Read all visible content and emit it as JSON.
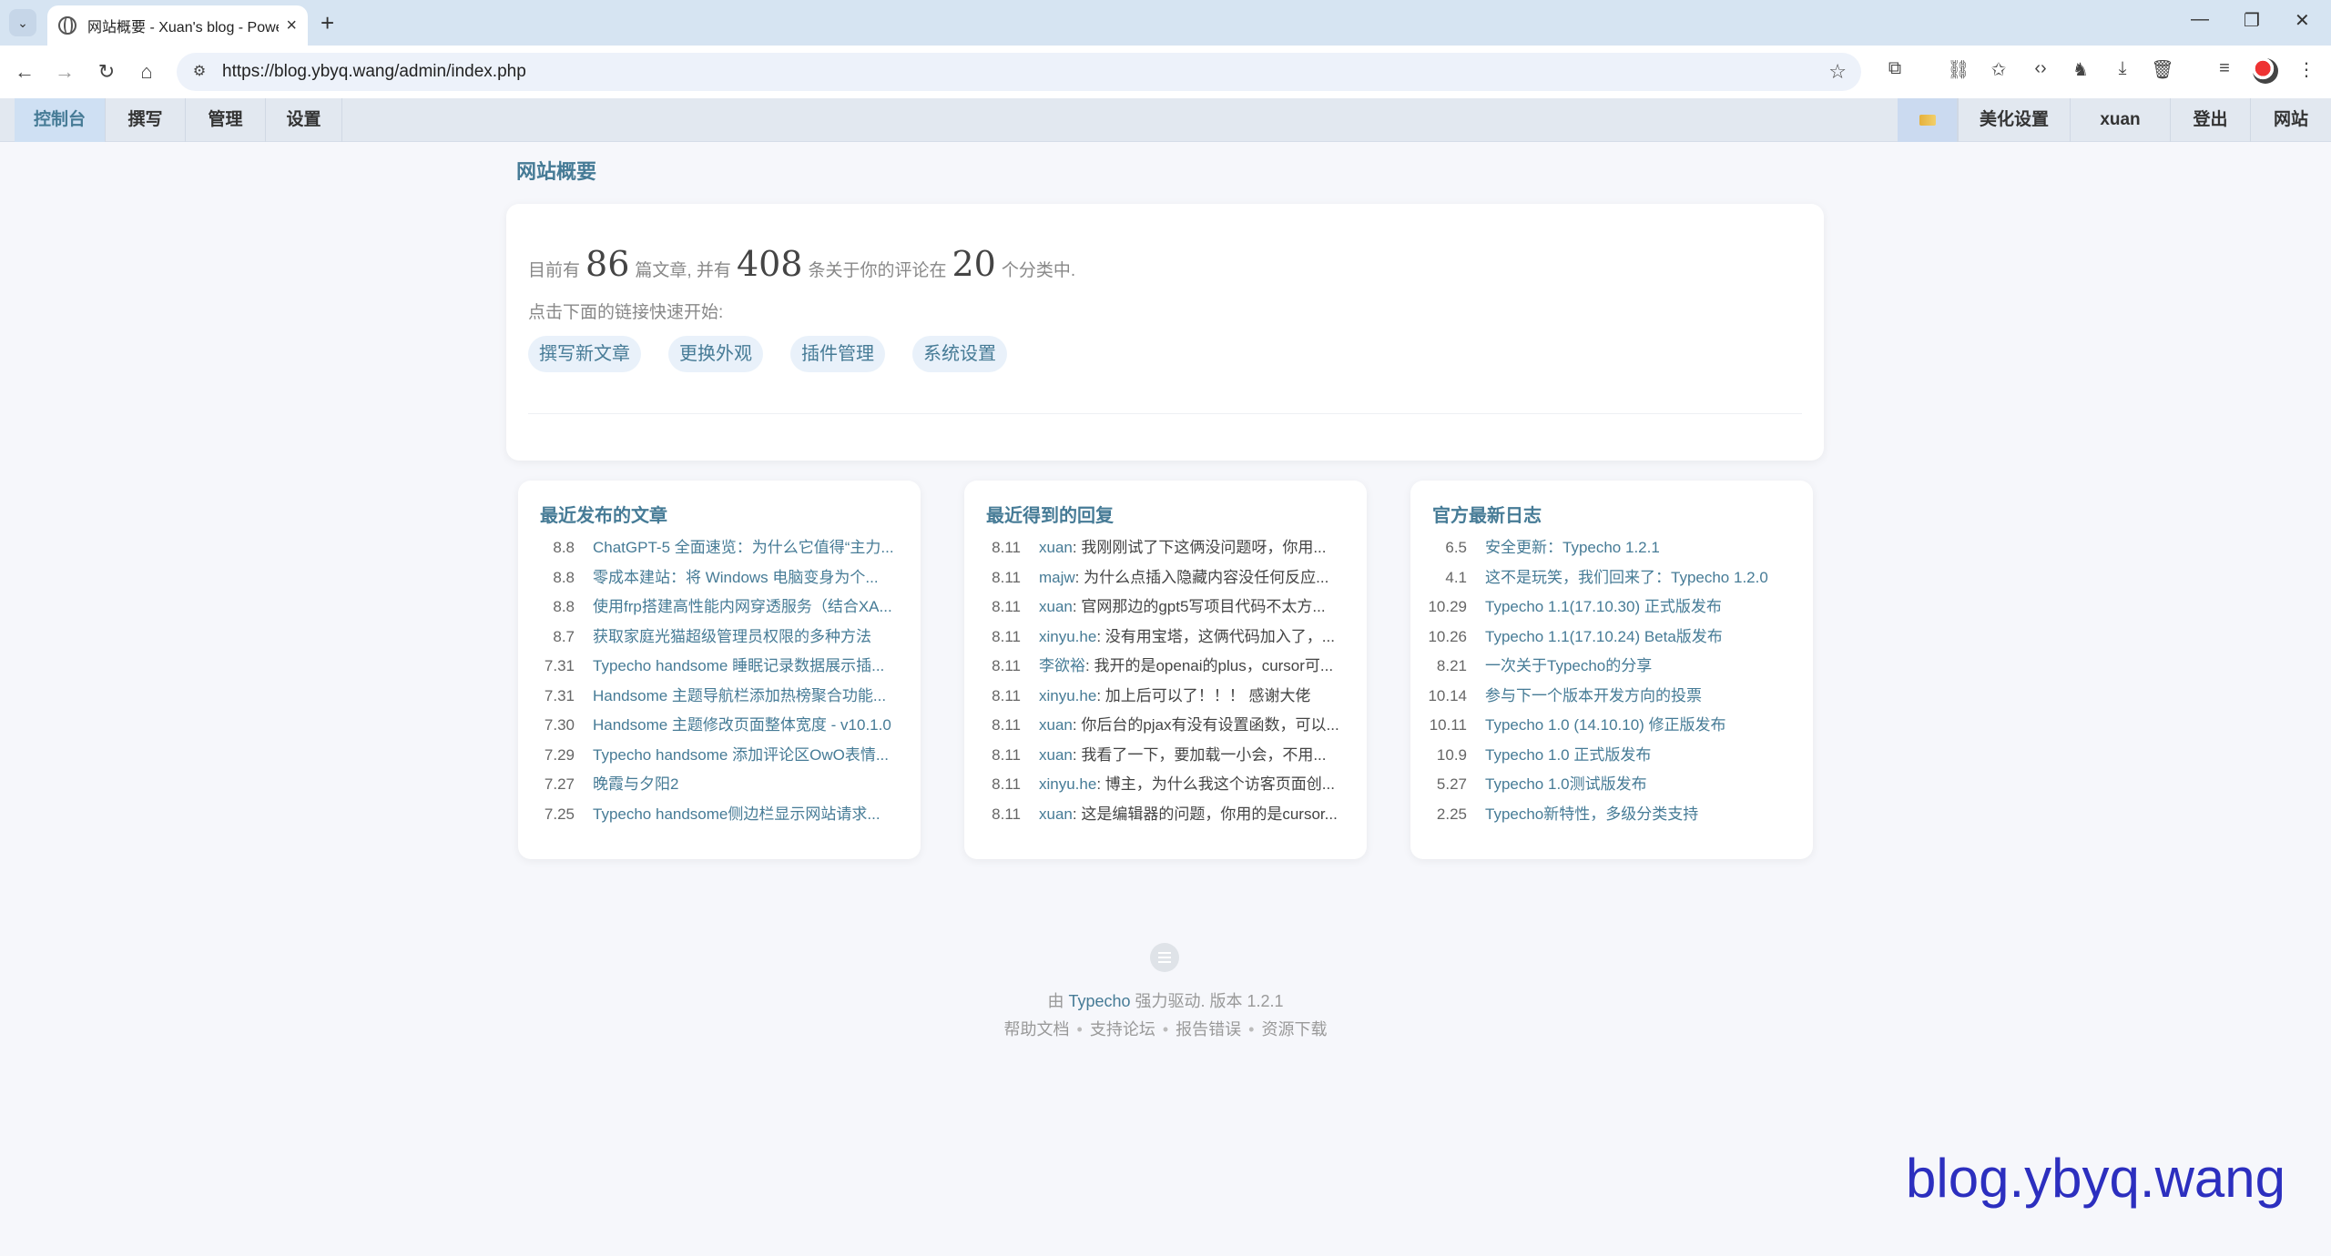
{
  "browser": {
    "tab_title": "网站概要 - Xuan's blog - Powered by Typecho",
    "url": "https://blog.ybyq.wang/admin/index.php"
  },
  "admin_nav": {
    "left": [
      "控制台",
      "撰写",
      "管理",
      "设置"
    ],
    "right": [
      "美化设置",
      "xuan",
      "登出",
      "网站"
    ]
  },
  "page": {
    "title": "网站概要",
    "summary": {
      "prefix": "目前有",
      "posts": "86",
      "mid1": "篇文章, 并有",
      "comments": "408",
      "mid2": "条关于你的评论在",
      "categories": "20",
      "suffix": "个分类中."
    },
    "hint": "点击下面的链接快速开始:",
    "quick_links": [
      "撰写新文章",
      "更换外观",
      "插件管理",
      "系统设置"
    ]
  },
  "recent_posts": {
    "title": "最近发布的文章",
    "items": [
      {
        "date": "8.8",
        "text": "ChatGPT-5 全面速览：为什么它值得“主力..."
      },
      {
        "date": "8.8",
        "text": "零成本建站：将 Windows 电脑变身为个..."
      },
      {
        "date": "8.8",
        "text": "使用frp搭建高性能内网穿透服务（结合XA..."
      },
      {
        "date": "8.7",
        "text": "获取家庭光猫超级管理员权限的多种方法"
      },
      {
        "date": "7.31",
        "text": "Typecho handsome 睡眠记录数据展示插..."
      },
      {
        "date": "7.31",
        "text": "Handsome 主题导航栏添加热榜聚合功能..."
      },
      {
        "date": "7.30",
        "text": "Handsome 主题修改页面整体宽度 - v10.1.0"
      },
      {
        "date": "7.29",
        "text": "Typecho handsome 添加评论区OwO表情..."
      },
      {
        "date": "7.27",
        "text": "晚霞与夕阳2"
      },
      {
        "date": "7.25",
        "text": "Typecho handsome侧边栏显示网站请求..."
      }
    ]
  },
  "recent_replies": {
    "title": "最近得到的回复",
    "items": [
      {
        "date": "8.11",
        "author": "xuan",
        "text": "我刚刚试了下这俩没问题呀，你用..."
      },
      {
        "date": "8.11",
        "author": "majw",
        "text": "为什么点插入隐藏内容没任何反应..."
      },
      {
        "date": "8.11",
        "author": "xuan",
        "text": "官网那边的gpt5写项目代码不太方..."
      },
      {
        "date": "8.11",
        "author": "xinyu.he",
        "text": "没有用宝塔，这俩代码加入了，..."
      },
      {
        "date": "8.11",
        "author": "李欲裕",
        "text": "我开的是openai的plus，cursor可..."
      },
      {
        "date": "8.11",
        "author": "xinyu.he",
        "text": "加上后可以了！！！ 感谢大佬"
      },
      {
        "date": "8.11",
        "author": "xuan",
        "text": "你后台的pjax有没有设置函数，可以..."
      },
      {
        "date": "8.11",
        "author": "xuan",
        "text": "我看了一下，要加载一小会，不用..."
      },
      {
        "date": "8.11",
        "author": "xinyu.he",
        "text": "博主，为什么我这个访客页面创..."
      },
      {
        "date": "8.11",
        "author": "xuan",
        "text": "这是编辑器的问题，你用的是cursor..."
      }
    ]
  },
  "official_log": {
    "title": "官方最新日志",
    "items": [
      {
        "date": "6.5",
        "text": "安全更新：Typecho 1.2.1"
      },
      {
        "date": "4.1",
        "text": "这不是玩笑，我们回来了：Typecho 1.2.0"
      },
      {
        "date": "10.29",
        "text": "Typecho 1.1(17.10.30) 正式版发布"
      },
      {
        "date": "10.26",
        "text": "Typecho 1.1(17.10.24) Beta版发布"
      },
      {
        "date": "8.21",
        "text": "一次关于Typecho的分享"
      },
      {
        "date": "10.14",
        "text": "参与下一个版本开发方向的投票"
      },
      {
        "date": "10.11",
        "text": "Typecho 1.0 (14.10.10) 修正版发布"
      },
      {
        "date": "10.9",
        "text": "Typecho 1.0 正式版发布"
      },
      {
        "date": "5.27",
        "text": "Typecho 1.0测试版发布"
      },
      {
        "date": "2.25",
        "text": "Typecho新特性，多级分类支持"
      }
    ]
  },
  "footer": {
    "powered_prefix": "由",
    "powered_link": "Typecho",
    "powered_suffix": "强力驱动. 版本 1.2.1",
    "links": [
      "帮助文档",
      "支持论坛",
      "报告错误",
      "资源下载"
    ]
  },
  "watermark": "blog.ybyq.wang"
}
